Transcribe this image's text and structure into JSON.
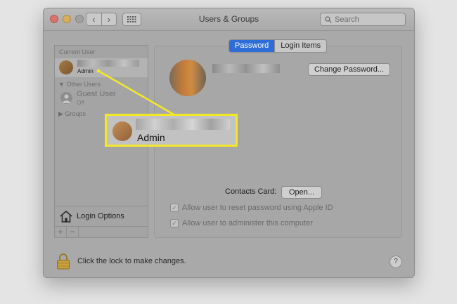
{
  "window": {
    "title": "Users & Groups"
  },
  "search": {
    "placeholder": "Search"
  },
  "sidebar": {
    "current_user_header": "Current User",
    "current_user_role": "Admin",
    "other_users_header": "Other Users",
    "guest_user": {
      "name": "Guest User",
      "status": "Off"
    },
    "groups_label": "Groups",
    "login_options": "Login Options",
    "add_button": "+",
    "remove_button": "−"
  },
  "tabs": [
    {
      "label": "Password",
      "active": true
    },
    {
      "label": "Login Items",
      "active": false
    }
  ],
  "main": {
    "change_password_button": "Change Password...",
    "contacts_card_label": "Contacts Card:",
    "open_button": "Open...",
    "checkbox_reset_password": {
      "label": "Allow user to reset password using Apple ID",
      "checked": true
    },
    "checkbox_administer": {
      "label": "Allow user to administer this computer",
      "checked": true
    }
  },
  "footer": {
    "lock_text": "Click the lock to make changes.",
    "help_button": "?"
  },
  "callout": {
    "role": "Admin",
    "highlight_color": "#f3e72b"
  },
  "icons": [
    "back-arrow-icon",
    "forward-arrow-icon",
    "grid-icon",
    "search-icon",
    "disclosure-triangle-icon",
    "guest-user-icon",
    "house-icon",
    "lock-icon",
    "help-icon"
  ]
}
